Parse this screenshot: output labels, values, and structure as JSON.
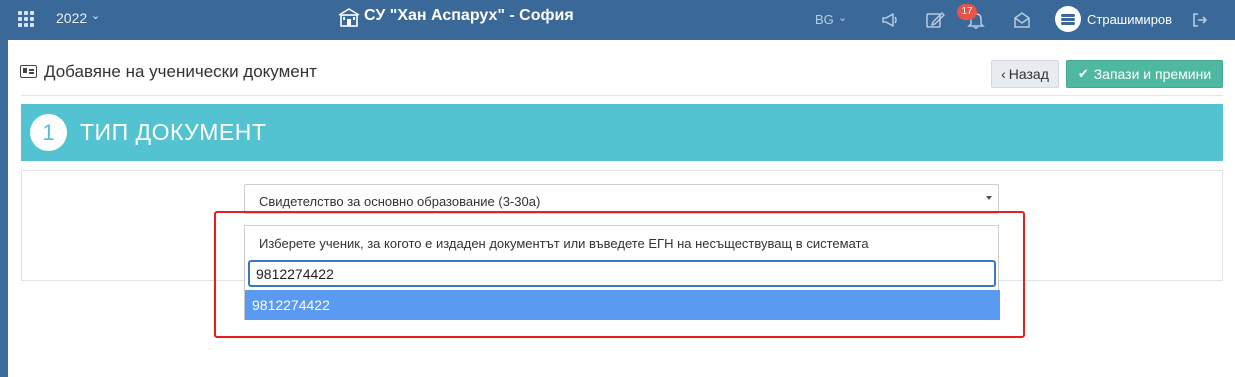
{
  "topbar": {
    "year": "2022",
    "school_name": "СУ \"Хан Аспарух\" - София",
    "language": "BG",
    "notification_count": "17",
    "user_name": "Страшимиров",
    "background_color": "#3a6899"
  },
  "page": {
    "title": "Добавяне на ученически документ",
    "back_label": "Назад",
    "save_label": "Запази и премини"
  },
  "step": {
    "number": "1",
    "title": "ТИП ДОКУМЕНТ",
    "accent_color": "#54c3d1"
  },
  "form": {
    "document_type_value": "Свидетелство за основно образование (3-30а)",
    "student_select_placeholder": "Изберете ученик, за когото е издаден документът или въведете ЕГН на несъществуващ в системата",
    "search_value": "9812274422",
    "options": [
      {
        "label": "9812274422",
        "highlighted": true
      }
    ]
  },
  "icons": {
    "menu": "grid-icon",
    "school": "school-building-icon",
    "announcements": "megaphone-icon",
    "edit": "edit-icon",
    "notifications": "bell-icon",
    "messages": "envelope-icon",
    "logout": "logout-icon",
    "page": "id-card-icon",
    "back": "chevron-left-icon",
    "save": "check-icon"
  },
  "colors": {
    "save_button": "#4fb8a0",
    "selected_option": "#5a9bf1",
    "annotation_box": "#e51f1f"
  }
}
